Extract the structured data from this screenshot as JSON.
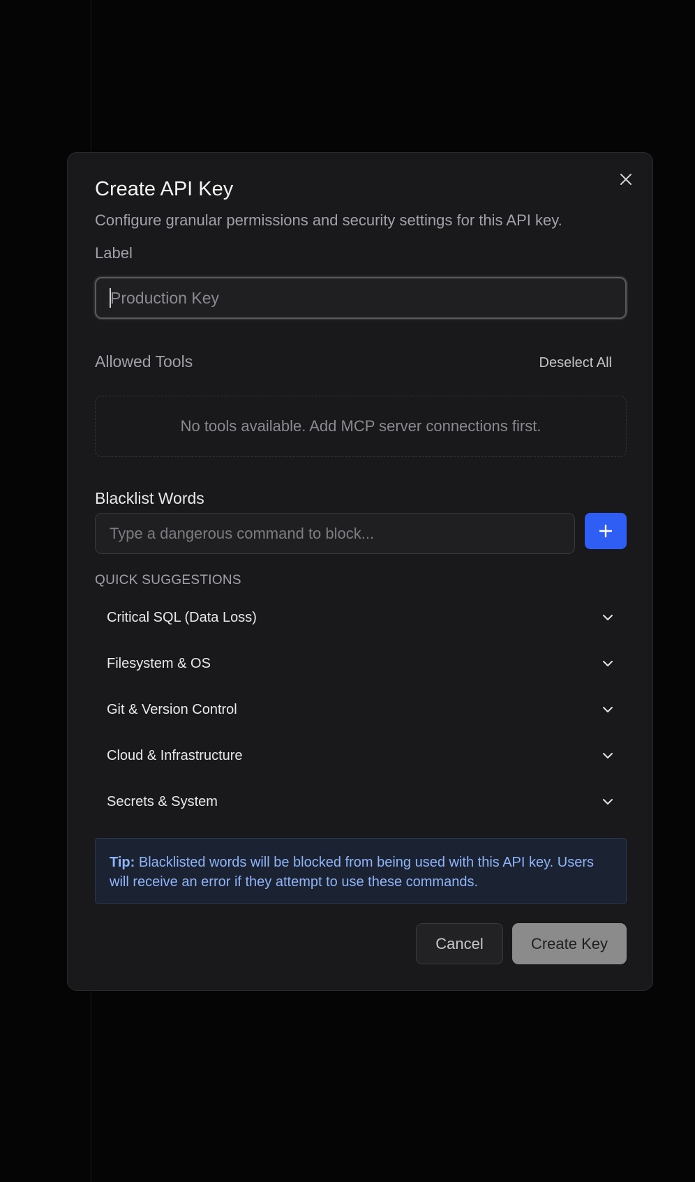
{
  "dialog": {
    "title": "Create API Key",
    "subtitle": "Configure granular permissions and security settings for this API key.",
    "close_icon": "close-icon"
  },
  "label_field": {
    "label": "Label",
    "placeholder": "Production Key",
    "value": ""
  },
  "allowed_tools": {
    "title": "Allowed Tools",
    "deselect_label": "Deselect All",
    "empty_message": "No tools available. Add MCP server connections first."
  },
  "blacklist": {
    "title": "Blacklist Words",
    "placeholder": "Type a dangerous command to block...",
    "add_icon": "plus-icon",
    "quick_heading": "QUICK SUGGESTIONS",
    "categories": [
      {
        "label": "Critical SQL (Data Loss)",
        "icon": "chevron-down-icon"
      },
      {
        "label": "Filesystem & OS",
        "icon": "chevron-down-icon"
      },
      {
        "label": "Git & Version Control",
        "icon": "chevron-down-icon"
      },
      {
        "label": "Cloud & Infrastructure",
        "icon": "chevron-down-icon"
      },
      {
        "label": "Secrets & System",
        "icon": "chevron-down-icon"
      }
    ]
  },
  "tip": {
    "prefix": "Tip:",
    "text": " Blacklisted words will be blocked from being used with this API key. Users will receive an error if they attempt to use these commands."
  },
  "footer": {
    "cancel_label": "Cancel",
    "create_label": "Create Key"
  },
  "colors": {
    "background": "#050505",
    "dialog": "#19191b",
    "accent": "#2f5ef5",
    "tip_text": "#8fb4f8",
    "create_disabled": "#8b8b8b"
  }
}
